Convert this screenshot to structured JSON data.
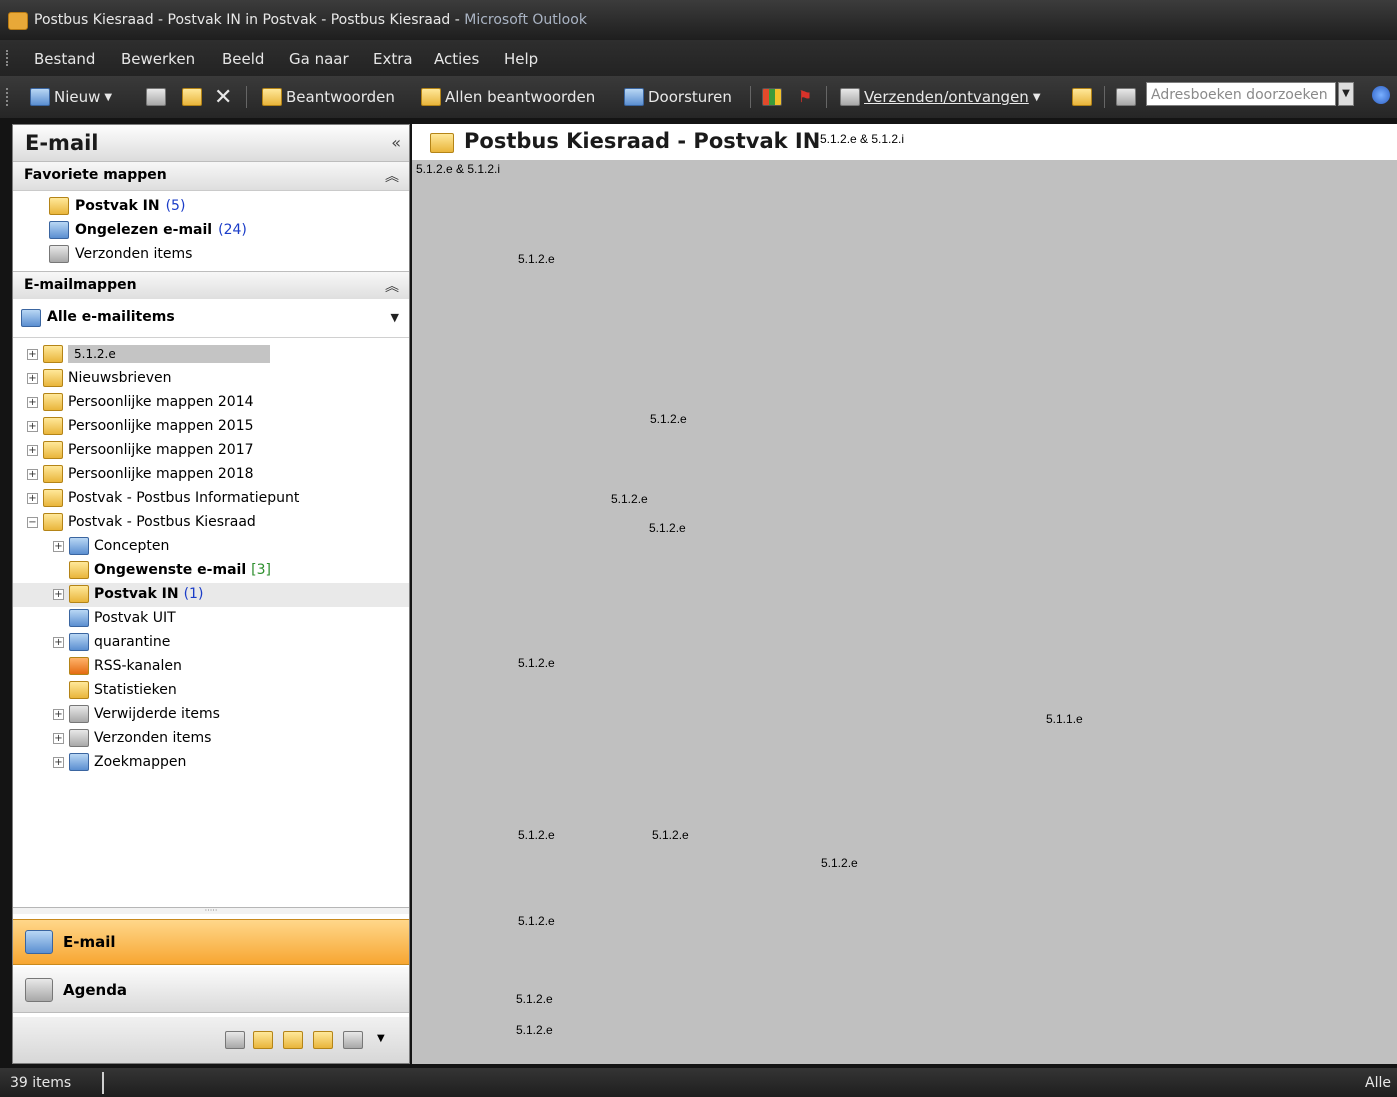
{
  "window": {
    "title_main": "Postbus Kiesraad - Postvak IN in Postvak - Postbus Kiesraad - ",
    "title_app": "Microsoft Outlook"
  },
  "menu": [
    "Bestand",
    "Bewerken",
    "Beeld",
    "Ga naar",
    "Extra",
    "Acties",
    "Help"
  ],
  "toolbar": {
    "new_label": "Nieuw",
    "reply_label": "Beantwoorden",
    "reply_all_label": "Allen beantwoorden",
    "forward_label": "Doorsturen",
    "send_receive_label": "Verzenden/ontvangen",
    "address_search_placeholder": "Adresboeken doorzoeken"
  },
  "nav": {
    "title": "E-mail",
    "collapse_glyph": "«",
    "favorites_header": "Favoriete mappen",
    "favorites": [
      {
        "label": "Postvak IN",
        "count": "(5)",
        "bold": true
      },
      {
        "label": "Ongelezen e-mail",
        "count": "(24)",
        "bold": true
      },
      {
        "label": "Verzonden items",
        "count": "",
        "bold": false
      }
    ],
    "mail_folders_header": "E-mailmappen",
    "all_mail_label": "Alle e-mailitems",
    "tree": [
      {
        "label": "5.1.2.e",
        "level": 0,
        "expander": "+",
        "masked": true
      },
      {
        "label": "Nieuwsbrieven",
        "level": 0,
        "expander": "+"
      },
      {
        "label": "Persoonlijke mappen 2014",
        "level": 0,
        "expander": "+"
      },
      {
        "label": "Persoonlijke mappen 2015",
        "level": 0,
        "expander": "+"
      },
      {
        "label": "Persoonlijke mappen 2017",
        "level": 0,
        "expander": "+"
      },
      {
        "label": "Persoonlijke mappen 2018",
        "level": 0,
        "expander": "+"
      },
      {
        "label": "Postvak - Postbus Informatiepunt",
        "level": 0,
        "expander": "+"
      },
      {
        "label": "Postvak - Postbus Kiesraad",
        "level": 0,
        "expander": "−"
      },
      {
        "label": "Concepten",
        "level": 1,
        "expander": "+"
      },
      {
        "label": "Ongewenste e-mail",
        "level": 1,
        "expander": "",
        "count": "[3]",
        "bold": true
      },
      {
        "label": "Postvak IN",
        "level": 1,
        "expander": "+",
        "count": "(1)",
        "bold": true,
        "selected": true
      },
      {
        "label": "Postvak UIT",
        "level": 1,
        "expander": ""
      },
      {
        "label": "quarantine",
        "level": 1,
        "expander": "+"
      },
      {
        "label": "RSS-kanalen",
        "level": 1,
        "expander": ""
      },
      {
        "label": "Statistieken",
        "level": 1,
        "expander": ""
      },
      {
        "label": "Verwijderde items",
        "level": 1,
        "expander": "+"
      },
      {
        "label": "Verzonden items",
        "level": 1,
        "expander": "+"
      },
      {
        "label": "Zoekmappen",
        "level": 1,
        "expander": "+"
      }
    ],
    "btn_mail": "E-mail",
    "btn_agenda": "Agenda"
  },
  "content": {
    "title": "Postbus Kiesraad - Postvak IN",
    "redactions": [
      {
        "text": "5.1.2.e & 5.1.2.i"
      },
      {
        "text": "5.1.2.e & 5.1.2.i"
      },
      {
        "text": "5.1.2.e"
      },
      {
        "text": "5.1.2.e"
      },
      {
        "text": "5.1.2.e"
      },
      {
        "text": "5.1.2.e"
      },
      {
        "text": "5.1.2.e"
      },
      {
        "text": "5.1.1.e"
      },
      {
        "text": "5.1.2.e"
      },
      {
        "text": "5.1.2.e"
      },
      {
        "text": "5.1.2.e"
      },
      {
        "text": "5.1.2.e"
      },
      {
        "text": "5.1.2.e"
      },
      {
        "text": "5.1.2.e"
      }
    ]
  },
  "status": {
    "items": "39 items",
    "right": "Alle"
  },
  "colors": {
    "accent_orange": "#f7a632",
    "count_blue": "#1a3cc8",
    "count_green": "#2d8f2d"
  }
}
